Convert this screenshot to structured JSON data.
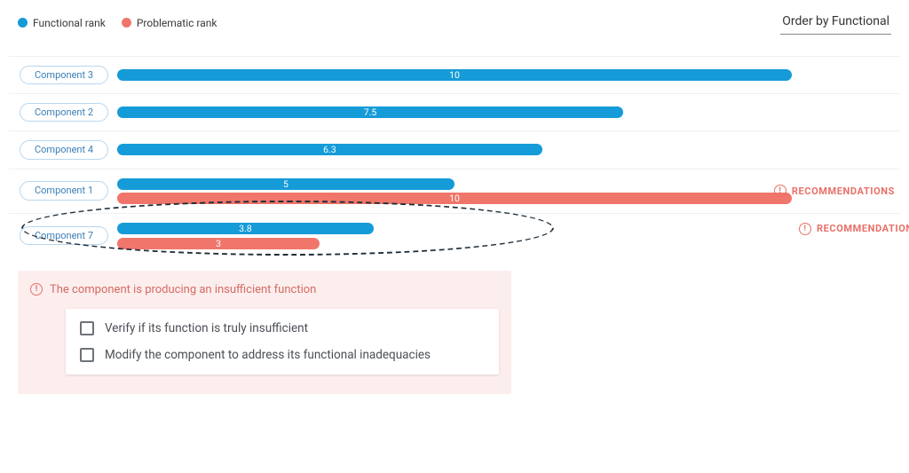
{
  "legend": {
    "functional": "Functional rank",
    "problematic": "Problematic rank"
  },
  "order_by_label": "Order by Functional",
  "colors": {
    "functional": "#159BD7",
    "problematic": "#F0766B",
    "highlight_stroke": "#1f2d38",
    "panel_bg": "#fdeeee",
    "accent_warn": "#E87068"
  },
  "max_value": 10,
  "recommendations_label": "RECOMMENDATIONS",
  "rows": [
    {
      "name": "Component 3",
      "functional": 10,
      "problematic": null,
      "recommendation_pos": null
    },
    {
      "name": "Component 2",
      "functional": 7.5,
      "problematic": null,
      "recommendation_pos": null
    },
    {
      "name": "Component 4",
      "functional": 6.3,
      "problematic": null,
      "recommendation_pos": null
    },
    {
      "name": "Component 1",
      "functional": 5,
      "problematic": 10,
      "recommendation_pos": "right"
    },
    {
      "name": "Component 7",
      "functional": 3.8,
      "problematic": 3,
      "recommendation_pos": "inline",
      "highlighted": true
    }
  ],
  "panel": {
    "title": "The component is producing an insufficient function",
    "items": [
      "Verify if its function is truly insufficient",
      "Modify the component to address its functional inadequacies"
    ]
  },
  "chart_data": {
    "type": "bar",
    "orientation": "horizontal",
    "title": "",
    "xlabel": "",
    "ylabel": "",
    "xlim": [
      0,
      10
    ],
    "categories": [
      "Component 3",
      "Component 2",
      "Component 4",
      "Component 1",
      "Component 7"
    ],
    "series": [
      {
        "name": "Functional rank",
        "color": "#159BD7",
        "values": [
          10,
          7.5,
          6.3,
          5,
          3.8
        ]
      },
      {
        "name": "Problematic rank",
        "color": "#F0766B",
        "values": [
          null,
          null,
          null,
          10,
          3
        ]
      }
    ],
    "annotations": [
      {
        "category": "Component 1",
        "text": "RECOMMENDATIONS"
      },
      {
        "category": "Component 7",
        "text": "RECOMMENDATIONS",
        "emphasized": true
      }
    ],
    "legend_position": "top-left",
    "sort_control": "Order by Functional"
  }
}
